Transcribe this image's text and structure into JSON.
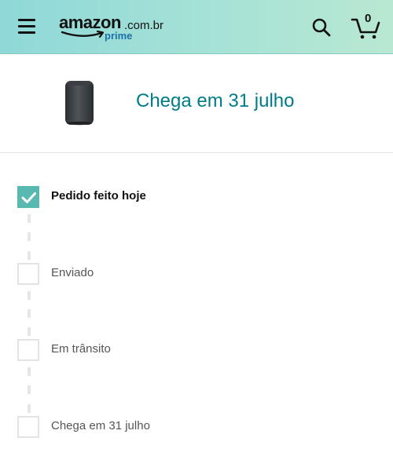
{
  "header": {
    "menu_icon": "hamburger-menu-icon",
    "logo": {
      "brand": "amazon",
      "tld": ".com.br",
      "tier": "prime"
    },
    "search_icon": "search-icon",
    "cart": {
      "icon": "cart-icon",
      "count": "0"
    }
  },
  "product": {
    "image": "echo-smart-speaker",
    "arrival_text": "Chega em 31 julho"
  },
  "tracker": {
    "steps": [
      {
        "label": "Pedido feito hoje",
        "completed": true
      },
      {
        "label": "Enviado",
        "completed": false
      },
      {
        "label": "Em trânsito",
        "completed": false
      },
      {
        "label": "Chega em 31 julho",
        "completed": false
      }
    ]
  },
  "colors": {
    "header_gradient_start": "#8fd8d8",
    "header_gradient_end": "#b9e8d2",
    "accent_teal": "#007c89",
    "check_fill": "#59b9b0",
    "prime_blue": "#1f6fa8"
  }
}
